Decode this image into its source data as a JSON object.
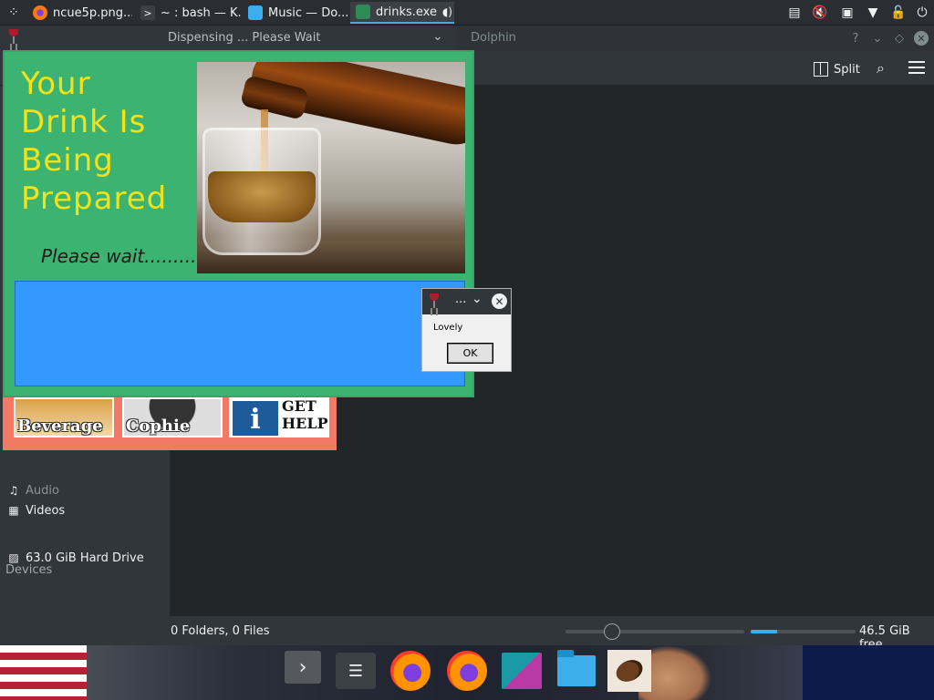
{
  "taskbar": {
    "tasks": [
      {
        "label": "ncue5p.png...",
        "icon": "firefox-icon"
      },
      {
        "label": "~ : bash — K...",
        "icon": "terminal-icon"
      },
      {
        "label": "Music — Do...",
        "icon": "dolphin-icon"
      },
      {
        "label": "drinks.exe",
        "icon": "wine-icon"
      }
    ],
    "tray_icons": [
      "clipboard-icon",
      "volume-muted-icon",
      "network-icon",
      "expand-tray-icon",
      "lock-icon",
      "power-icon"
    ]
  },
  "dolphin": {
    "title": "Dolphin",
    "help_btn": "?",
    "split_label": "Split",
    "sidebar": {
      "places": [
        {
          "label": "Audio",
          "icon": "music-note-icon"
        },
        {
          "label": "Videos",
          "icon": "film-icon"
        }
      ],
      "devices_header": "Devices",
      "devices": [
        {
          "label": "63.0 GiB Hard Drive",
          "icon": "hard-drive-icon"
        }
      ]
    },
    "status": {
      "counts": "0 Folders, 0 Files",
      "free": "46.5 GiB free",
      "free_fraction": 0.25
    }
  },
  "drinks": {
    "window_title": "Dispensing ... Please Wait",
    "headline": "Your Drink Is Being Prepared",
    "please_wait": "Please wait.........",
    "colors": {
      "background": "#3cb371",
      "headline": "#f2e21a",
      "progress_box": "#3399ff"
    },
    "menu_tiles": [
      {
        "label": "Beverage"
      },
      {
        "label": "Cophie"
      },
      {
        "label": "GET\nHELP"
      }
    ]
  },
  "dialog": {
    "title": "...",
    "message": "Lovely",
    "ok_label": "OK"
  },
  "dock": {
    "items": [
      "arrow-right-icon",
      "system-settings-icon",
      "firefox-icon",
      "firefox-icon",
      "kdeconnect-icon",
      "folder-icon",
      "coffee-bean-icon"
    ]
  }
}
